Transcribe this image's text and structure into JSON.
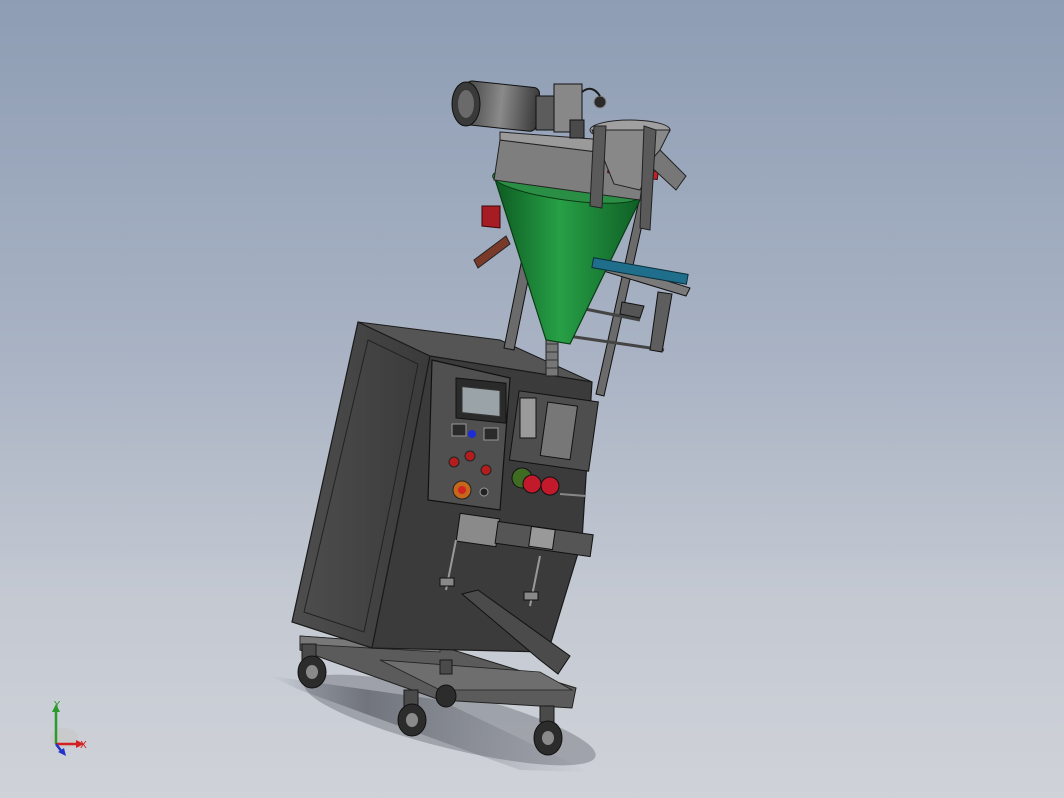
{
  "viewport": {
    "background_top": "#8e9db4",
    "background_bottom": "#cfd2d8"
  },
  "model": {
    "hopper_color": "#1f8a3c",
    "cabinet_color": "#3d3d3d",
    "frame_color": "#6b6b6b"
  },
  "triad": {
    "x_label": "X",
    "y_label": "Y",
    "x_color": "#d42020",
    "y_color": "#2a9a2a",
    "z_color": "#2233cc"
  }
}
